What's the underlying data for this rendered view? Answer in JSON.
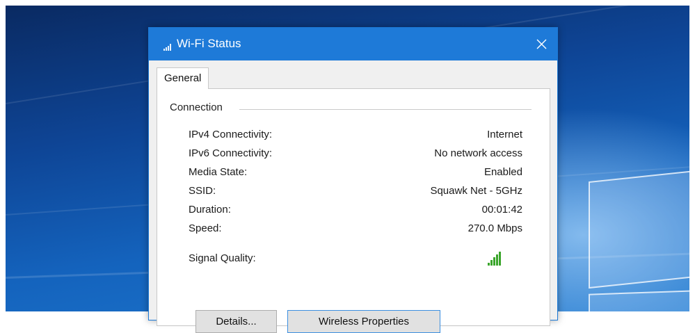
{
  "window": {
    "title": "Wi-Fi Status",
    "title_icon": "wifi-signal-icon",
    "close_icon": "close-icon"
  },
  "tabs": [
    {
      "label": "General",
      "selected": true
    }
  ],
  "connection": {
    "group_label": "Connection",
    "rows": [
      {
        "label": "IPv4 Connectivity:",
        "value": "Internet"
      },
      {
        "label": "IPv6 Connectivity:",
        "value": "No network access"
      },
      {
        "label": "Media State:",
        "value": "Enabled"
      },
      {
        "label": "SSID:",
        "value": "Squawk Net - 5GHz"
      },
      {
        "label": "Duration:",
        "value": "00:01:42"
      },
      {
        "label": "Speed:",
        "value": "270.0 Mbps"
      }
    ],
    "signal_quality": {
      "label": "Signal Quality:",
      "icon": "signal-bars-icon",
      "bars_filled": 5,
      "bars_total": 5,
      "color": "#3aa52b"
    }
  },
  "buttons": {
    "details": "Details...",
    "wireless_properties": "Wireless Properties"
  },
  "colors": {
    "titlebar": "#1e7ad8",
    "desktop": "#1463bd"
  }
}
